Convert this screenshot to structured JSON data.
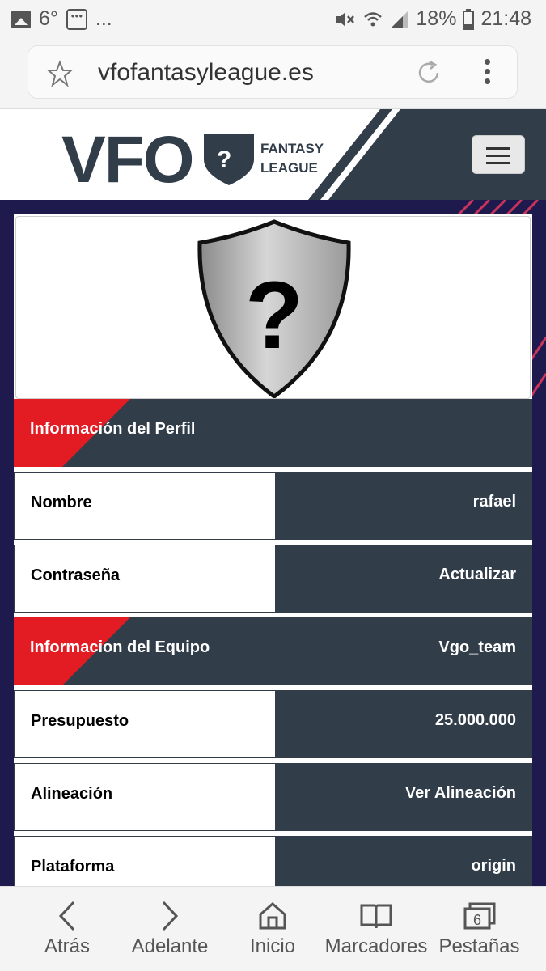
{
  "status_bar": {
    "temperature": "6°",
    "more": "...",
    "battery": "18%",
    "time": "21:48"
  },
  "browser": {
    "url": "vfofantasyleague.es"
  },
  "site": {
    "logo_text": "VFO",
    "logo_sub_1": "FANTASY",
    "logo_sub_2": "LEAGUE"
  },
  "profile": {
    "section_title": "Información del Perfil",
    "rows": [
      {
        "label": "Nombre",
        "value": "rafael"
      },
      {
        "label": "Contraseña",
        "value": "Actualizar"
      }
    ]
  },
  "team": {
    "section_title": "Informacion del Equipo",
    "team_name": "Vgo_team",
    "rows": [
      {
        "label": "Presupuesto",
        "value": "25.000.000"
      },
      {
        "label": "Alineación",
        "value": "Ver Alineación"
      },
      {
        "label": "Plataforma",
        "value": "origin"
      }
    ]
  },
  "bottom_nav": {
    "back": "Atrás",
    "forward": "Adelante",
    "home": "Inicio",
    "bookmarks": "Marcadores",
    "tabs": "Pestañas",
    "tabs_count": "6"
  },
  "colors": {
    "dark_panel": "#323d4a",
    "page_bg": "#1f1a4e",
    "accent_red": "#e31b23"
  }
}
